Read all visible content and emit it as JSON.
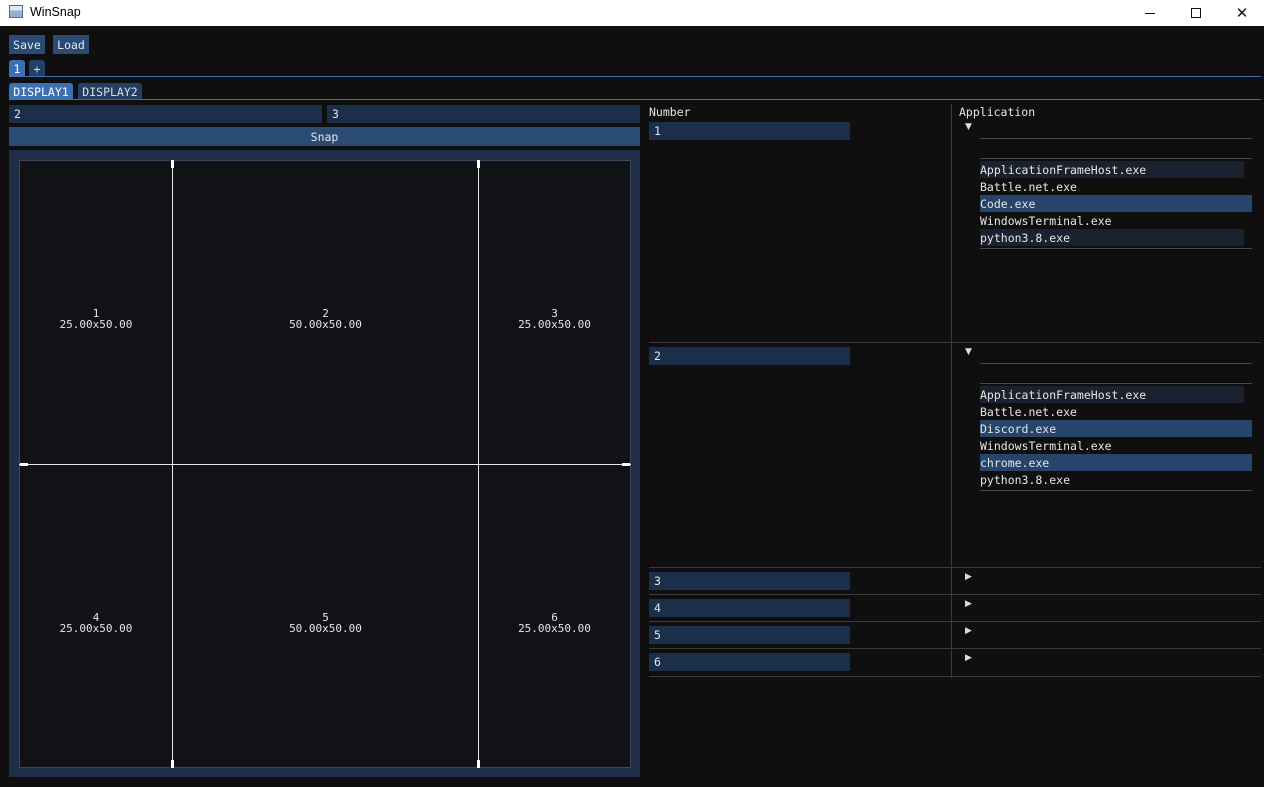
{
  "window": {
    "title": "WinSnap"
  },
  "toolbar": {
    "save": "Save",
    "load": "Load"
  },
  "layout_tabs": [
    "1",
    "+"
  ],
  "display_tabs": [
    "DISPLAY1",
    "DISPLAY2"
  ],
  "grid": {
    "cols": "2",
    "rows": "3",
    "snap": "Snap"
  },
  "cells": [
    {
      "num": "1",
      "size": "25.00x50.00"
    },
    {
      "num": "2",
      "size": "50.00x50.00"
    },
    {
      "num": "3",
      "size": "25.00x50.00"
    },
    {
      "num": "4",
      "size": "25.00x50.00"
    },
    {
      "num": "5",
      "size": "50.00x50.00"
    },
    {
      "num": "6",
      "size": "25.00x50.00"
    }
  ],
  "table": {
    "col_number": "Number",
    "col_application": "Application",
    "rows": [
      {
        "number": "1",
        "expanded": true,
        "apps": [
          "ApplicationFrameHost.exe",
          "Battle.net.exe",
          "Code.exe",
          "WindowsTerminal.exe",
          "python3.8.exe"
        ]
      },
      {
        "number": "2",
        "expanded": true,
        "apps": [
          "ApplicationFrameHost.exe",
          "Battle.net.exe",
          "Discord.exe",
          "WindowsTerminal.exe",
          "chrome.exe",
          "python3.8.exe"
        ]
      },
      {
        "number": "3",
        "expanded": false
      },
      {
        "number": "4",
        "expanded": false
      },
      {
        "number": "5",
        "expanded": false
      },
      {
        "number": "6",
        "expanded": false
      }
    ]
  },
  "icons": {
    "expanded": "▼",
    "collapsed": "▶"
  },
  "colors": {
    "accent": "#3d70b3",
    "button": "#2a4b74",
    "frame_bg": "#1c2f4a",
    "background": "#0f0f0f"
  }
}
